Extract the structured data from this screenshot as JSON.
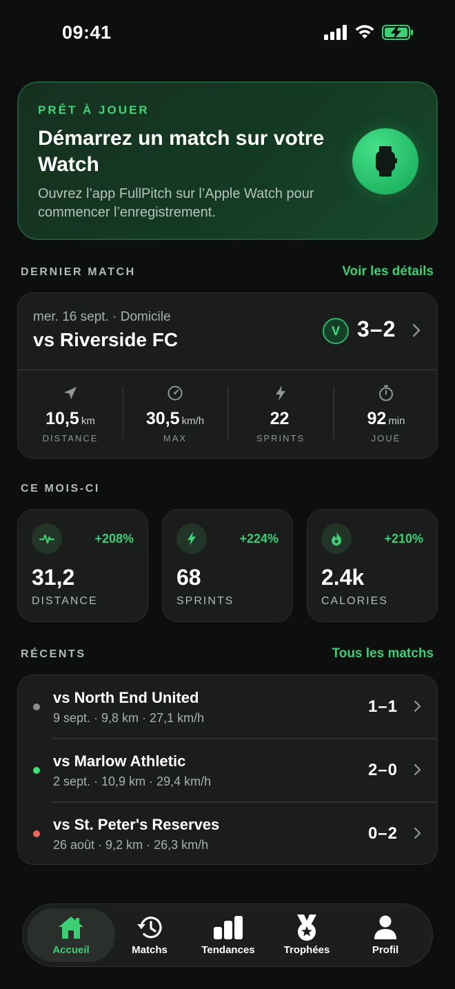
{
  "status_bar": {
    "time": "09:41"
  },
  "hero": {
    "eyebrow": "PRÊT À JOUER",
    "title": "Démarrez un match sur votre Watch",
    "subtitle": "Ouvrez l’app FullPitch sur l’Apple Watch pour commencer l’enregistrement.",
    "button_icon": "watch-icon"
  },
  "last_match_section": {
    "label": "DERNIER MATCH",
    "link": "Voir les détails"
  },
  "last_match": {
    "meta": "mer. 16 sept. · Domicile",
    "opponent": "vs Riverside FC",
    "result_badge": "V",
    "score": "3–2",
    "stats": [
      {
        "icon": "location-arrow-icon",
        "value": "10,5",
        "unit": "km",
        "label": "DISTANCE"
      },
      {
        "icon": "speedometer-icon",
        "value": "30,5",
        "unit": "km/h",
        "label": "MAX"
      },
      {
        "icon": "bolt-icon",
        "value": "22",
        "unit": "",
        "label": "SPRINTS"
      },
      {
        "icon": "stopwatch-icon",
        "value": "92",
        "unit": "min",
        "label": "JOUÉ"
      }
    ]
  },
  "month_section": {
    "label": "CE MOIS-CI"
  },
  "month_cards": [
    {
      "icon": "pulse-icon",
      "change": "+208%",
      "value": "31,2",
      "label": "DISTANCE"
    },
    {
      "icon": "bolt-icon",
      "change": "+224%",
      "value": "68",
      "label": "SPRINTS"
    },
    {
      "icon": "flame-icon",
      "change": "+210%",
      "value": "2.4k",
      "label": "CALORIES"
    }
  ],
  "recent_section": {
    "label": "RÉCENTS",
    "link": "Tous les matchs"
  },
  "recent_matches": [
    {
      "opponent": "vs North End United",
      "meta": "9 sept. · 9,8 km · 27,1 km/h",
      "score": "1–1",
      "result_color": "#8a8f8c"
    },
    {
      "opponent": "vs Marlow Athletic",
      "meta": "2 sept. · 10,9 km · 29,4 km/h",
      "score": "2–0",
      "result_color": "#3ee07a"
    },
    {
      "opponent": "vs St. Peter's Reserves",
      "meta": "26 août · 9,2 km · 26,3 km/h",
      "score": "0–2",
      "result_color": "#f0625f"
    }
  ],
  "tabbar": {
    "tabs": [
      {
        "label": "Accueil",
        "icon": "home-icon",
        "active": true
      },
      {
        "label": "Matchs",
        "icon": "history-icon",
        "active": false
      },
      {
        "label": "Tendances",
        "icon": "bar-chart-icon",
        "active": false
      },
      {
        "label": "Trophées",
        "icon": "medal-icon",
        "active": false
      },
      {
        "label": "Profil",
        "icon": "person-icon",
        "active": false
      }
    ]
  },
  "colors": {
    "accent": "#3ecf75",
    "background": "#0d0f0e",
    "card": "#1a1d1c"
  }
}
